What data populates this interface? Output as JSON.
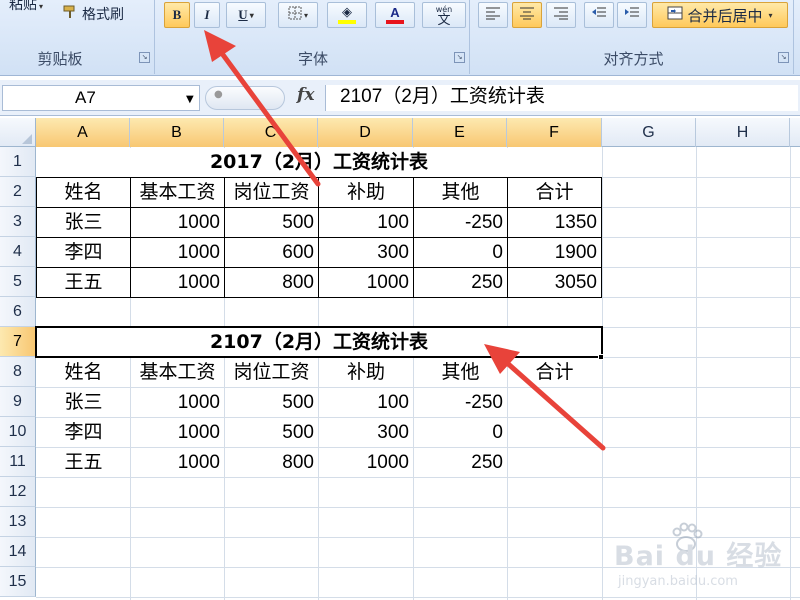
{
  "ribbon": {
    "clipboard": {
      "paste_label": "粘贴",
      "format_painter_label": "格式刷",
      "group_label": "剪贴板"
    },
    "font": {
      "bold_label": "B",
      "italic_label": "I",
      "underline_label": "U",
      "font_color_label": "A",
      "phonetic_label_top": "wén",
      "phonetic_label": "文",
      "group_label": "字体",
      "font_color": "#e8141c",
      "fill_color": "#ffff00"
    },
    "alignment": {
      "merge_center_label": "合并后居中",
      "group_label": "对齐方式"
    }
  },
  "formula_bar": {
    "name_box": "A7",
    "formula": "2107（2月）工资统计表",
    "fx_label": "fx"
  },
  "grid": {
    "columns": [
      "A",
      "B",
      "C",
      "D",
      "E",
      "F",
      "G",
      "H"
    ],
    "rows": [
      "1",
      "2",
      "3",
      "4",
      "5",
      "6",
      "7",
      "8",
      "9",
      "10",
      "11",
      "12",
      "13",
      "14",
      "15"
    ],
    "selected_column_headers": [
      "A",
      "B",
      "C",
      "D",
      "E",
      "F"
    ],
    "selected_row": "7"
  },
  "table1": {
    "title": "2017（2月）工资统计表",
    "headers": [
      "姓名",
      "基本工资",
      "岗位工资",
      "补助",
      "其他",
      "合计"
    ],
    "rows": [
      [
        "张三",
        "1000",
        "500",
        "100",
        "-250",
        "1350"
      ],
      [
        "李四",
        "1000",
        "600",
        "300",
        "0",
        "1900"
      ],
      [
        "王五",
        "1000",
        "800",
        "1000",
        "250",
        "3050"
      ]
    ]
  },
  "table2": {
    "title": "2107（2月）工资统计表",
    "headers": [
      "姓名",
      "基本工资",
      "岗位工资",
      "补助",
      "其他",
      "合计"
    ],
    "rows": [
      [
        "张三",
        "1000",
        "500",
        "100",
        "-250"
      ],
      [
        "李四",
        "1000",
        "500",
        "300",
        "0"
      ],
      [
        "王五",
        "1000",
        "800",
        "1000",
        "250"
      ]
    ]
  },
  "watermark": {
    "brand": "Bai du 经验",
    "url": "jingyan.baidu.com"
  },
  "colors": {
    "highlight": "#f8c772",
    "arrow": "#e8433a"
  }
}
